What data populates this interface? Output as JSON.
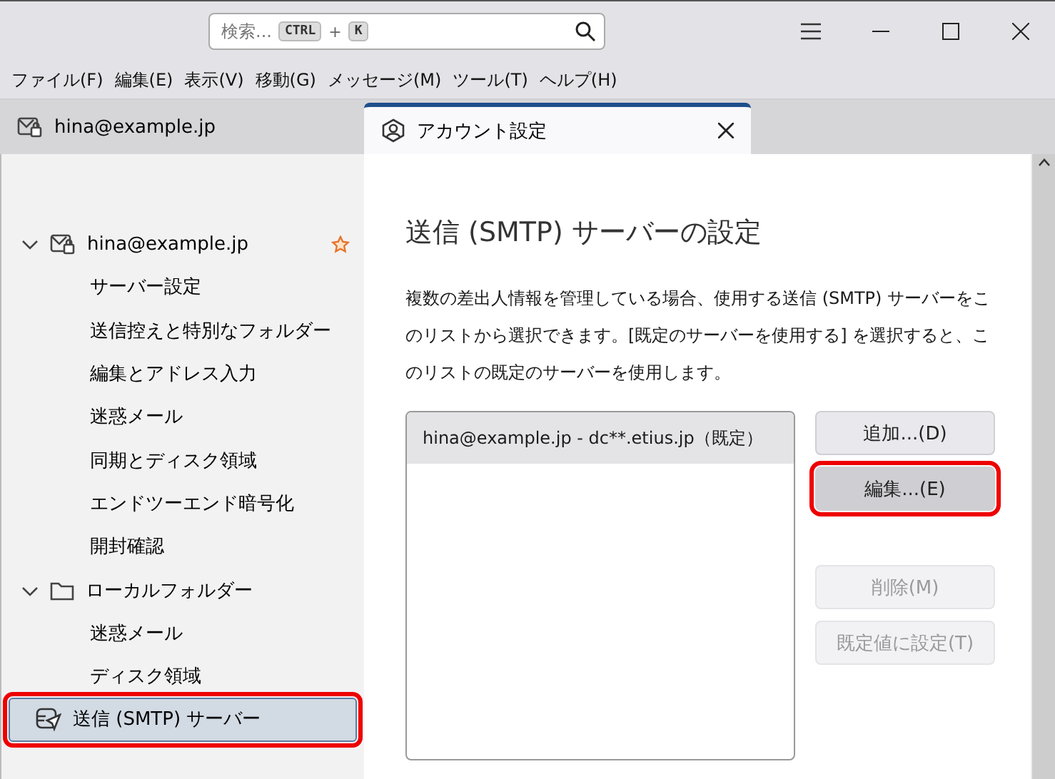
{
  "search": {
    "placeholder": "検索...",
    "shortcut": [
      "CTRL",
      "+",
      "K"
    ]
  },
  "menu": [
    "ファイル(F)",
    "編集(E)",
    "表示(V)",
    "移動(G)",
    "メッセージ(M)",
    "ツール(T)",
    "ヘルプ(H)"
  ],
  "tabs": [
    {
      "label": "hina@example.jp",
      "kind": "mail",
      "selected": false
    },
    {
      "label": "アカウント設定",
      "kind": "account",
      "selected": true
    }
  ],
  "sidebar": {
    "items": [
      {
        "label": "hina@example.jp",
        "kind": "mail",
        "expanded": true,
        "default": true,
        "selected": false,
        "highlighted": false,
        "children": [
          {
            "label": "サーバー設定",
            "selected": false
          },
          {
            "label": "送信控えと特別なフォルダー",
            "selected": false
          },
          {
            "label": "編集とアドレス入力",
            "selected": false
          },
          {
            "label": "迷惑メール",
            "selected": false
          },
          {
            "label": "同期とディスク領域",
            "selected": false
          },
          {
            "label": "エンドツーエンド暗号化",
            "selected": false
          },
          {
            "label": "開封確認",
            "selected": false
          }
        ]
      },
      {
        "label": "ローカルフォルダー",
        "kind": "folder",
        "expanded": true,
        "default": false,
        "selected": false,
        "highlighted": false,
        "children": [
          {
            "label": "迷惑メール",
            "selected": false
          },
          {
            "label": "ディスク領域",
            "selected": false
          }
        ]
      },
      {
        "label": "送信 (SMTP) サーバー",
        "kind": "outgoing",
        "selected": true,
        "highlighted": true
      }
    ]
  },
  "page": {
    "title": "送信 (SMTP) サーバーの設定",
    "description": "複数の差出人情報を管理している場合、使用する送信 (SMTP) サーバーをこのリストから選択できます。[既定のサーバーを使用する] を選択すると、このリストの既定のサーバーを使用します。",
    "servers": [
      {
        "label": "hina@example.jp - dc**.etius.jp（既定）",
        "selected": true
      }
    ],
    "buttons": [
      {
        "label": "追加...(D)",
        "disabled": false,
        "highlighted": false
      },
      {
        "label": "編集...(E)",
        "disabled": false,
        "highlighted": true
      },
      {
        "label": "削除(M)",
        "disabled": true,
        "highlighted": false
      },
      {
        "label": "既定値に設定(T)",
        "disabled": true,
        "highlighted": false
      }
    ]
  }
}
